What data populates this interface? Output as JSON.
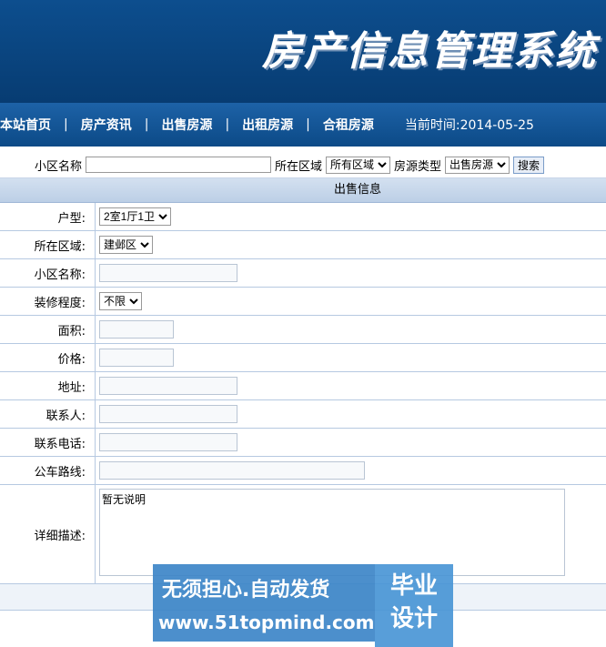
{
  "banner": {
    "title": "房产信息管理系统"
  },
  "nav": {
    "items": [
      "本站首页",
      "房产资讯",
      "出售房源",
      "出租房源",
      "合租房源"
    ],
    "separator": "|",
    "time_label": "当前时间:2014-05-25"
  },
  "search": {
    "community_label": "小区名称",
    "community_value": "",
    "area_label": "所在区域",
    "area_selected": "所有区域",
    "type_label": "房源类型",
    "type_selected": "出售房源",
    "search_button": "搜索"
  },
  "section": {
    "title": "出售信息"
  },
  "form": {
    "layout_label": "户型:",
    "layout_value": "2室1厅1卫",
    "district_label": "所在区域:",
    "district_value": "建邺区",
    "community_label": "小区名称:",
    "community_value": "",
    "decoration_label": "装修程度:",
    "decoration_value": "不限",
    "area_label": "面积:",
    "price_label": "价格:",
    "address_label": "地址:",
    "contact_label": "联系人:",
    "phone_label": "联系电话:",
    "bus_label": "公车路线:",
    "desc_label": "详细描述:",
    "desc_value": "暂无说明"
  },
  "watermark": {
    "line1": "无须担心.自动发货",
    "line2": "www.51topmind.com",
    "badge": "毕业\n设计"
  }
}
